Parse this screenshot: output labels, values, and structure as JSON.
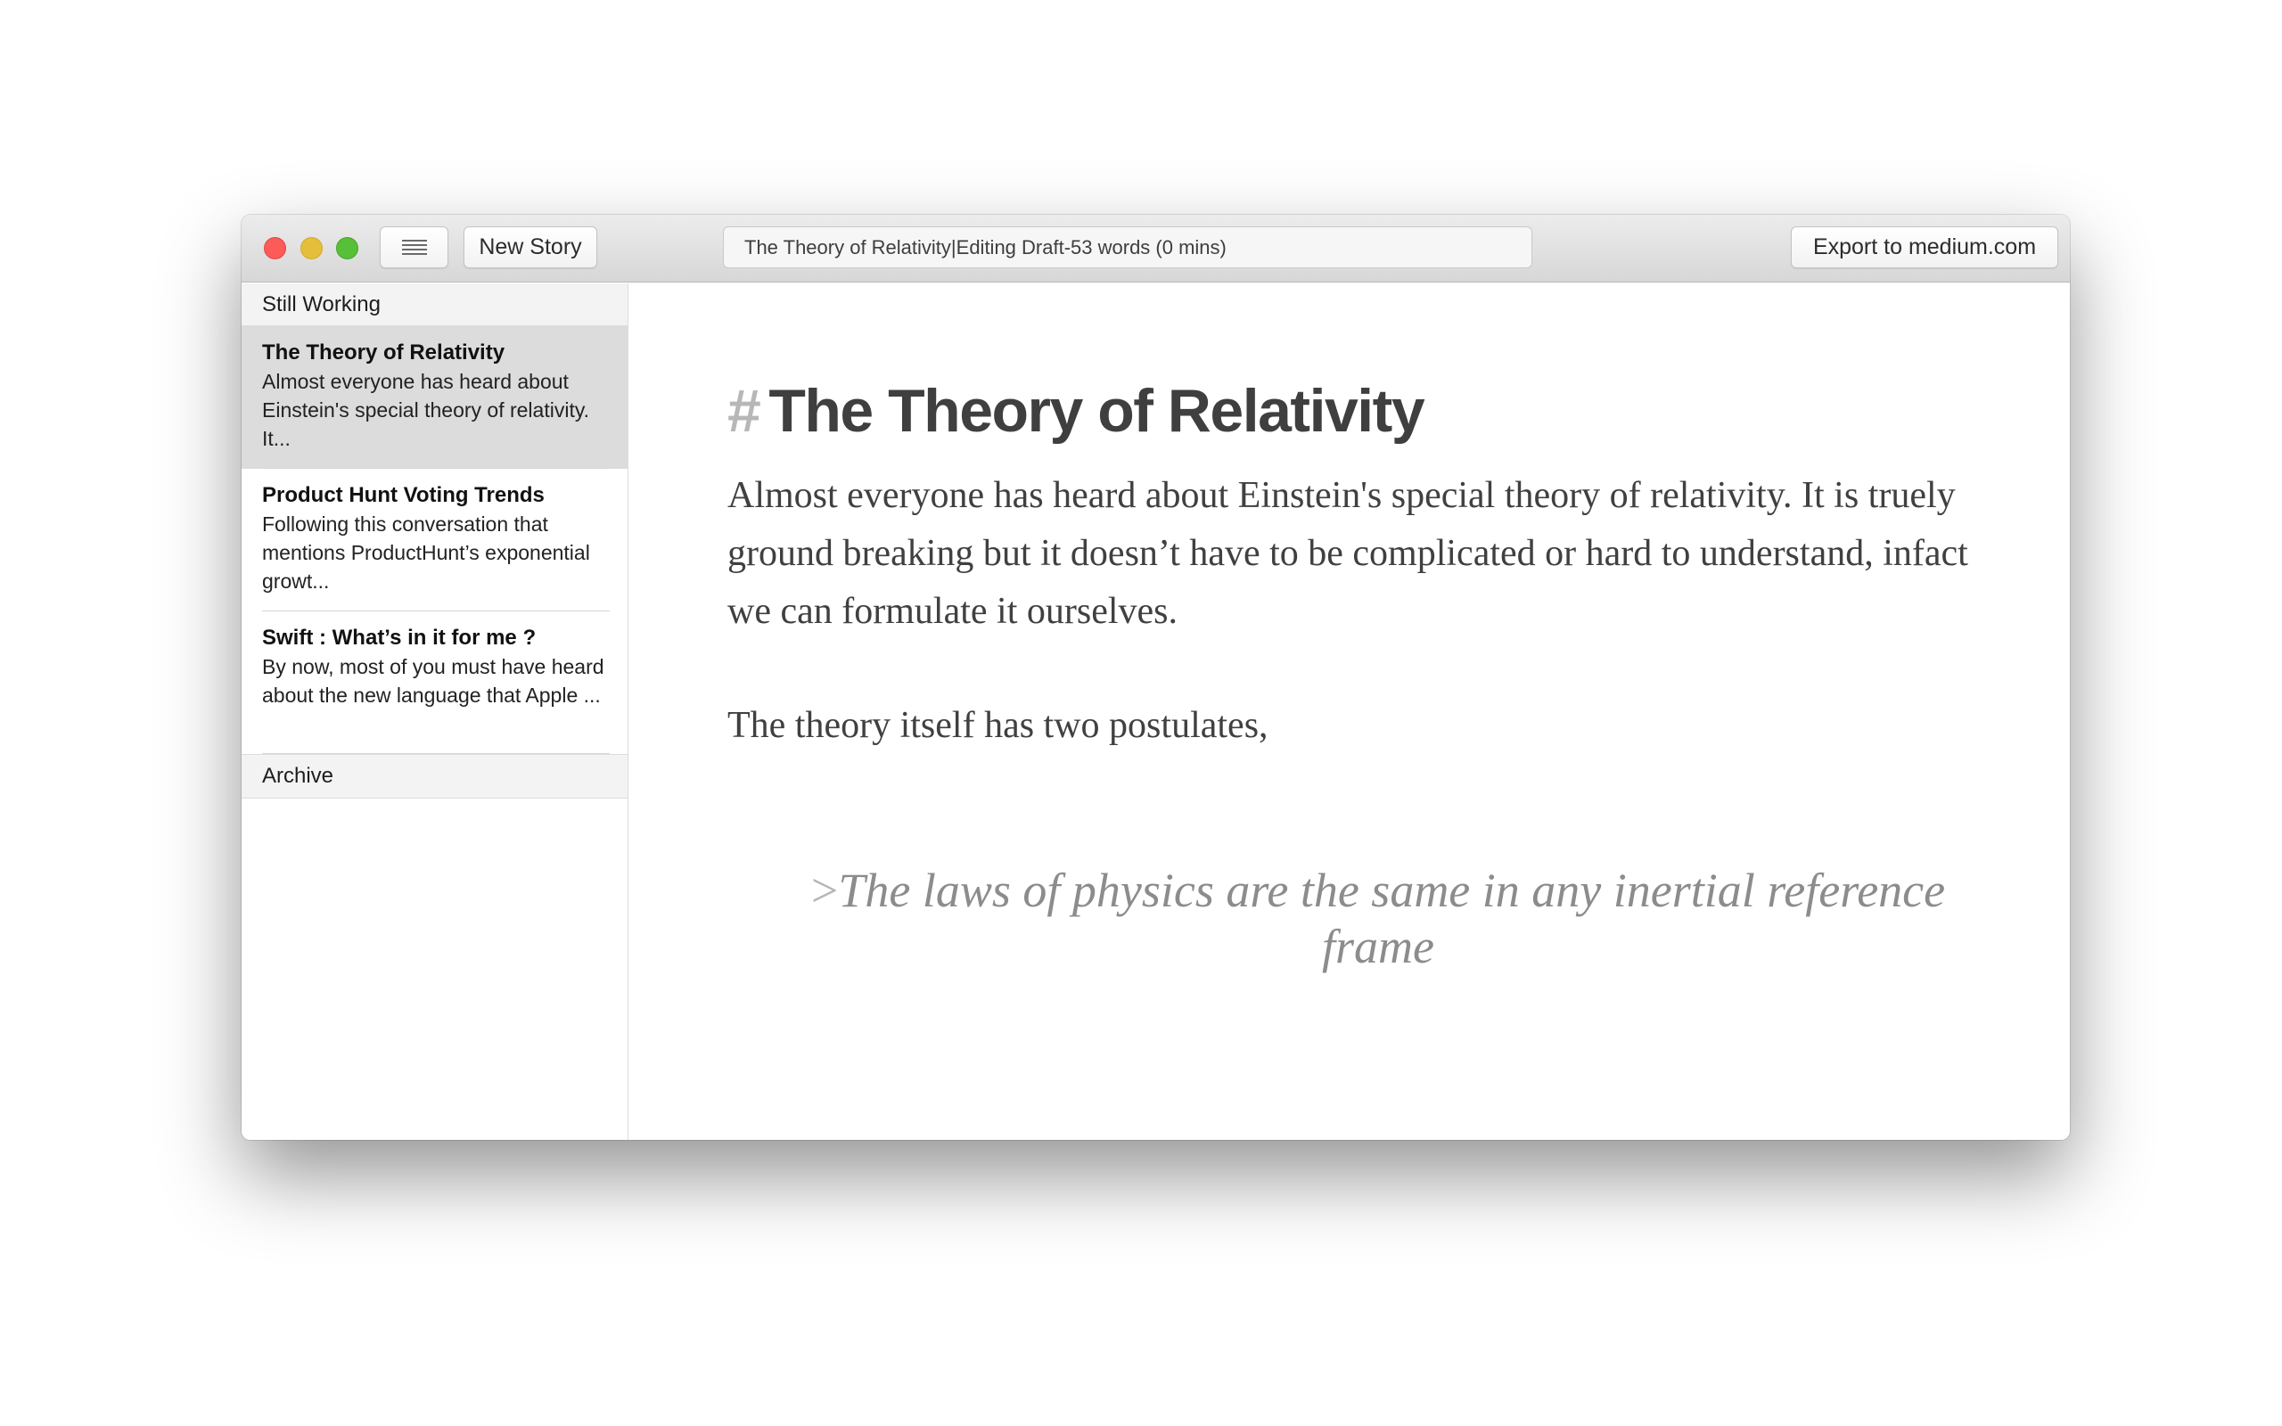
{
  "toolbar": {
    "new_story_label": "New Story",
    "status": {
      "story_title": "The Theory of Relativity",
      "separator": "|",
      "mode": "Editing Draft",
      "dash": "-",
      "word_count": "53 words (0 mins)"
    },
    "export_label": "Export to medium.com"
  },
  "sidebar": {
    "sections": [
      {
        "label": "Still Working",
        "items": [
          {
            "title": "The Theory of Relativity",
            "excerpt": "Almost everyone has heard about Einstein's special theory of relativity. It...",
            "selected": true
          },
          {
            "title": "Product Hunt Voting Trends",
            "excerpt": "Following this conversation that mentions ProductHunt’s exponential growt..."
          },
          {
            "title": "Swift : What’s in it for me ?",
            "excerpt": "By now, most of you must have heard about the new language that Apple ..."
          }
        ]
      },
      {
        "label": "Archive",
        "items": []
      }
    ]
  },
  "editor": {
    "heading_marker": "#",
    "heading": "The Theory of Relativity",
    "paragraphs": [
      "Almost everyone has heard about Einstein's special theory of relativity. It is truely ground breaking but it doesn’t have to be complicated or hard to understand, infact we can formulate it ourselves.",
      "The theory itself has two postulates,"
    ],
    "quote_marker": ">",
    "quote": "The laws of physics are the same in any inertial reference frame"
  },
  "colors": {
    "close": "#fc5b57",
    "minimize": "#e5bf3c",
    "maximize": "#57c038",
    "selected_row": "#dcdcdc",
    "heading_marker": "#b7b7b7",
    "quote_text": "#8c8c8c"
  },
  "icons": {
    "sidebar_toggle": "list-lines-icon",
    "close": "close-window-icon",
    "minimize": "minimize-window-icon",
    "maximize": "maximize-window-icon"
  }
}
